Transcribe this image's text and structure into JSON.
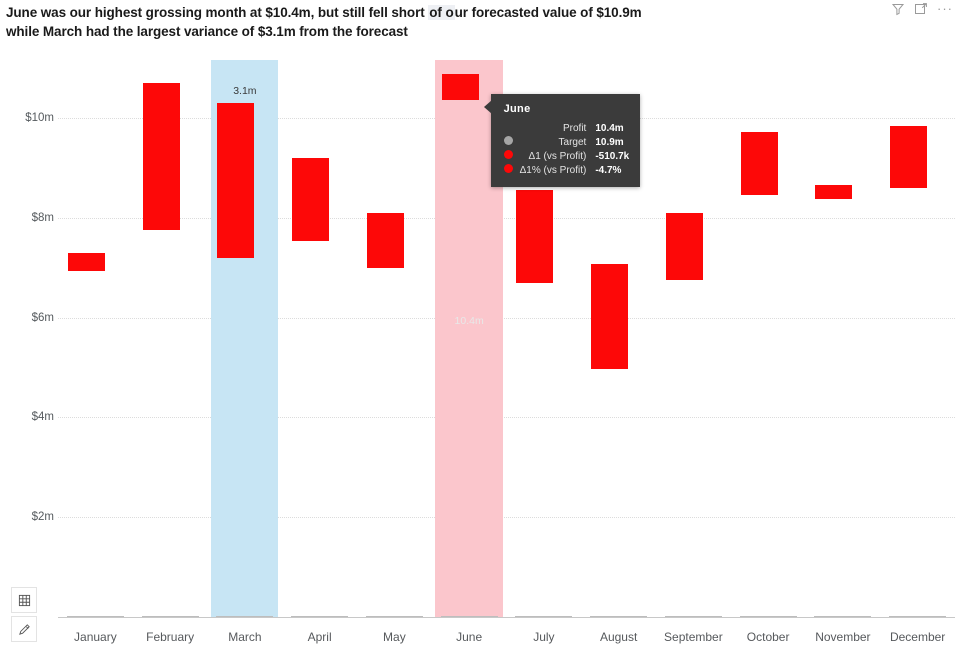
{
  "header": {
    "title_line1_a": "June was our highest grossing month at $10.4m, but still fell short ",
    "title_line1_hl": "of o",
    "title_line1_b": "ur forecasted value of $10.9m",
    "title_line2": "while March had the largest variance of $3.1m from the forecast",
    "icons": {
      "filter": "filter-icon",
      "focus": "focus-mode-icon",
      "more": "···"
    }
  },
  "footer_buttons": {
    "table_view": "table-view-icon",
    "edit": "edit-pencil-icon"
  },
  "tooltip": {
    "title": "June",
    "rows": [
      {
        "marker": "none",
        "color": "",
        "label": "Profit",
        "value": "10.4m"
      },
      {
        "marker": "dot",
        "color": "#a6a6a6",
        "label": "Target",
        "value": "10.9m"
      },
      {
        "marker": "dot",
        "color": "#fd0808",
        "label": "Δ1 (vs Profit)",
        "value": "-510.7k"
      },
      {
        "marker": "dot",
        "color": "#fd0808",
        "label": "Δ1% (vs Profit)",
        "value": "-4.7%"
      }
    ]
  },
  "chart_data": {
    "type": "bar",
    "title": "June was our highest grossing month at $10.4m, but still fell short of our forecasted value of $10.9m while March had the largest variance of $3.1m from the forecast",
    "xlabel": "",
    "ylabel": "",
    "ylim": [
      0,
      11.2
    ],
    "grid": true,
    "legend": "none",
    "ytick_values": [
      2,
      4,
      6,
      8,
      10
    ],
    "ytick_labels": [
      "$2m",
      "$4m",
      "$6m",
      "$8m",
      "$10m"
    ],
    "categories": [
      "January",
      "February",
      "March",
      "April",
      "May",
      "June",
      "July",
      "August",
      "September",
      "October",
      "November",
      "December"
    ],
    "series": [
      {
        "name": "Profit",
        "color": "#333333",
        "values": [
          6.93,
          7.75,
          7.2,
          7.53,
          7.0,
          10.36,
          6.7,
          4.97,
          6.75,
          8.45,
          8.38,
          8.6
        ]
      },
      {
        "name": "Target",
        "color": "#a6a6a6",
        "values": [
          7.3,
          10.7,
          10.3,
          9.2,
          8.1,
          10.88,
          8.55,
          7.07,
          8.1,
          9.72,
          8.65,
          9.85
        ]
      }
    ],
    "variance": {
      "positive_color": "#1a95f5",
      "negative_color": "#fd0808",
      "values": [
        0.37,
        -2.95,
        3.1,
        1.67,
        -1.1,
        -0.51,
        1.85,
        2.1,
        1.35,
        1.27,
        0.27,
        -1.25
      ]
    },
    "data_labels": [
      {
        "category": "March",
        "text": "3.1m"
      },
      {
        "category": "June",
        "text": "10.4m"
      }
    ],
    "highlights": [
      {
        "category": "March",
        "color": "#c7e5f4"
      },
      {
        "category": "June",
        "color": "#fbc6cc"
      }
    ]
  }
}
